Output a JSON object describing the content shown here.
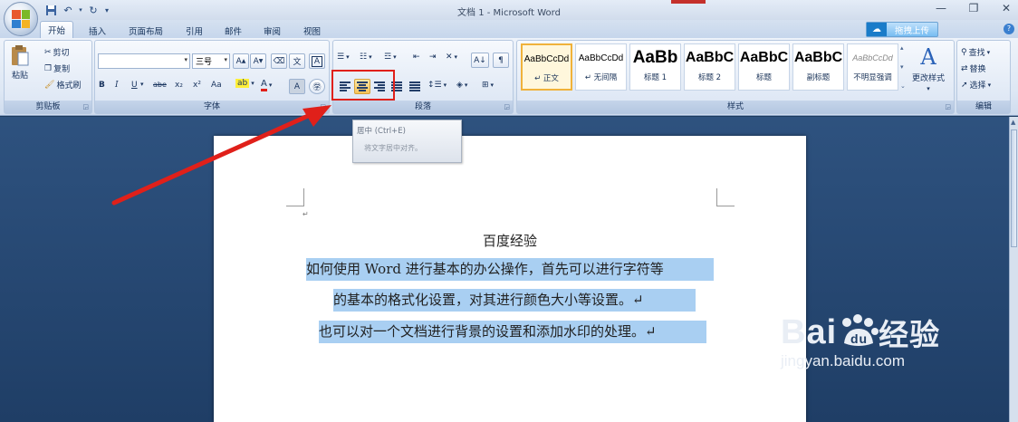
{
  "window": {
    "title": "文档 1 - Microsoft Word",
    "upload_label": "拖拽上传"
  },
  "tabs": [
    "开始",
    "插入",
    "页面布局",
    "引用",
    "邮件",
    "审阅",
    "视图"
  ],
  "clipboard": {
    "paste": "粘贴",
    "cut": "剪切",
    "copy": "复制",
    "format_painter": "格式刷",
    "group_label": "剪贴板"
  },
  "font": {
    "font_name": "",
    "font_size": "三号",
    "group_label": "字体",
    "format_buttons": [
      "B",
      "I",
      "U",
      "abe",
      "x₂",
      "x²",
      "Aa"
    ]
  },
  "paragraph": {
    "group_label": "段落",
    "selected_alignment": "center"
  },
  "styles": {
    "group_label": "样式",
    "items": [
      {
        "sample": "AaBbCcDd",
        "name": "↵ 正文",
        "selected": true
      },
      {
        "sample": "AaBbCcDd",
        "name": "↵ 无间隔",
        "selected": false
      },
      {
        "sample": "AaBb",
        "name": "标题 1",
        "selected": false
      },
      {
        "sample": "AaBbC",
        "name": "标题 2",
        "selected": false
      },
      {
        "sample": "AaBbC",
        "name": "标题",
        "selected": false
      },
      {
        "sample": "AaBbC",
        "name": "副标题",
        "selected": false
      },
      {
        "sample": "AaBbCcDd",
        "name": "不明显强调",
        "selected": false
      }
    ],
    "change_styles": "更改样式"
  },
  "editing": {
    "find": "查找",
    "replace": "替换",
    "select": "选择",
    "group_label": "编辑"
  },
  "tooltip": {
    "title": "居中 (Ctrl+E)",
    "description": "将文字居中对齐。"
  },
  "document": {
    "heading": "百度经验",
    "lines": [
      "如何使用 Word 进行基本的办公操作，首先可以进行字符等",
      "的基本的格式化设置，对其进行颜色大小等设置。↵",
      "也可以对一个文档进行背景的设置和添加水印的处理。↵"
    ]
  },
  "watermark": {
    "brand": "Bai",
    "brand2": "经验",
    "url": "jingyan.baidu.com"
  },
  "colors": {
    "selection": "#a9cff2",
    "highlight_box": "#e0201a",
    "arrow": "#e0201a"
  }
}
